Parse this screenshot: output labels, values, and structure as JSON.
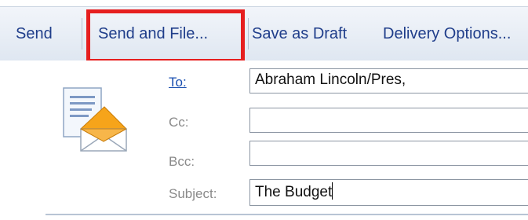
{
  "toolbar": {
    "send_label": "Send",
    "send_and_file_label": "Send and File...",
    "save_as_draft_label": "Save as Draft",
    "delivery_options_label": "Delivery Options..."
  },
  "highlight": {
    "color": "#e61f1f",
    "target": "send_and_file"
  },
  "icon": {
    "name": "new-mail-envelope-icon"
  },
  "fields": {
    "to": {
      "label": "To:",
      "value": "Abraham Lincoln/Pres,"
    },
    "cc": {
      "label": "Cc:",
      "value": ""
    },
    "bcc": {
      "label": "Bcc:",
      "value": ""
    },
    "subject": {
      "label": "Subject:",
      "value": "The Budget"
    }
  },
  "colors": {
    "toolbar_text": "#1f3d8a",
    "link": "#1a4fb0",
    "label": "#8a8a8a"
  }
}
